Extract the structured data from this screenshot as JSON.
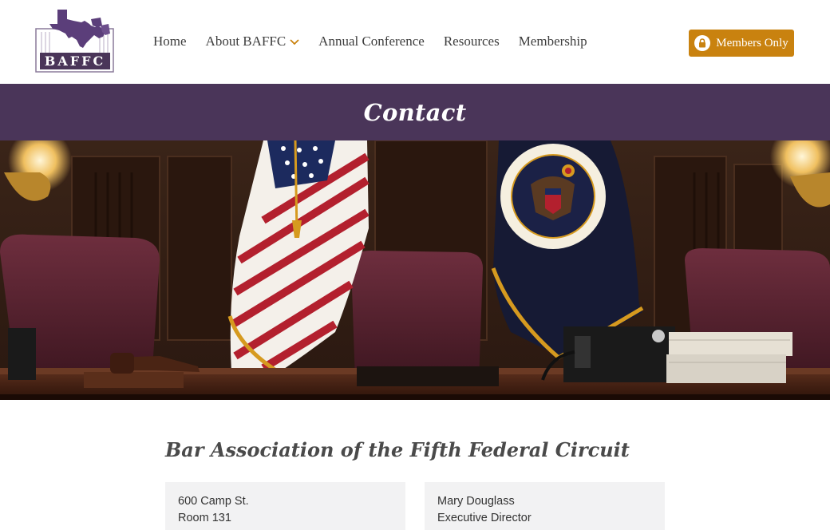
{
  "header": {
    "logo_text": "BAFFC",
    "nav": [
      {
        "label": "Home"
      },
      {
        "label": "About BAFFC",
        "has_dropdown": true
      },
      {
        "label": "Annual Conference"
      },
      {
        "label": "Resources"
      },
      {
        "label": "Membership"
      }
    ],
    "members_button": "Members Only"
  },
  "page": {
    "title": "Contact"
  },
  "content": {
    "heading": "Bar Association of the Fifth Federal Circuit",
    "address": {
      "line1": "600 Camp St.",
      "line2": "Room 131"
    },
    "contact": {
      "name": "Mary Douglass",
      "role": "Executive Director"
    }
  },
  "colors": {
    "purple": "#4a3559",
    "gold": "#c9820f"
  }
}
